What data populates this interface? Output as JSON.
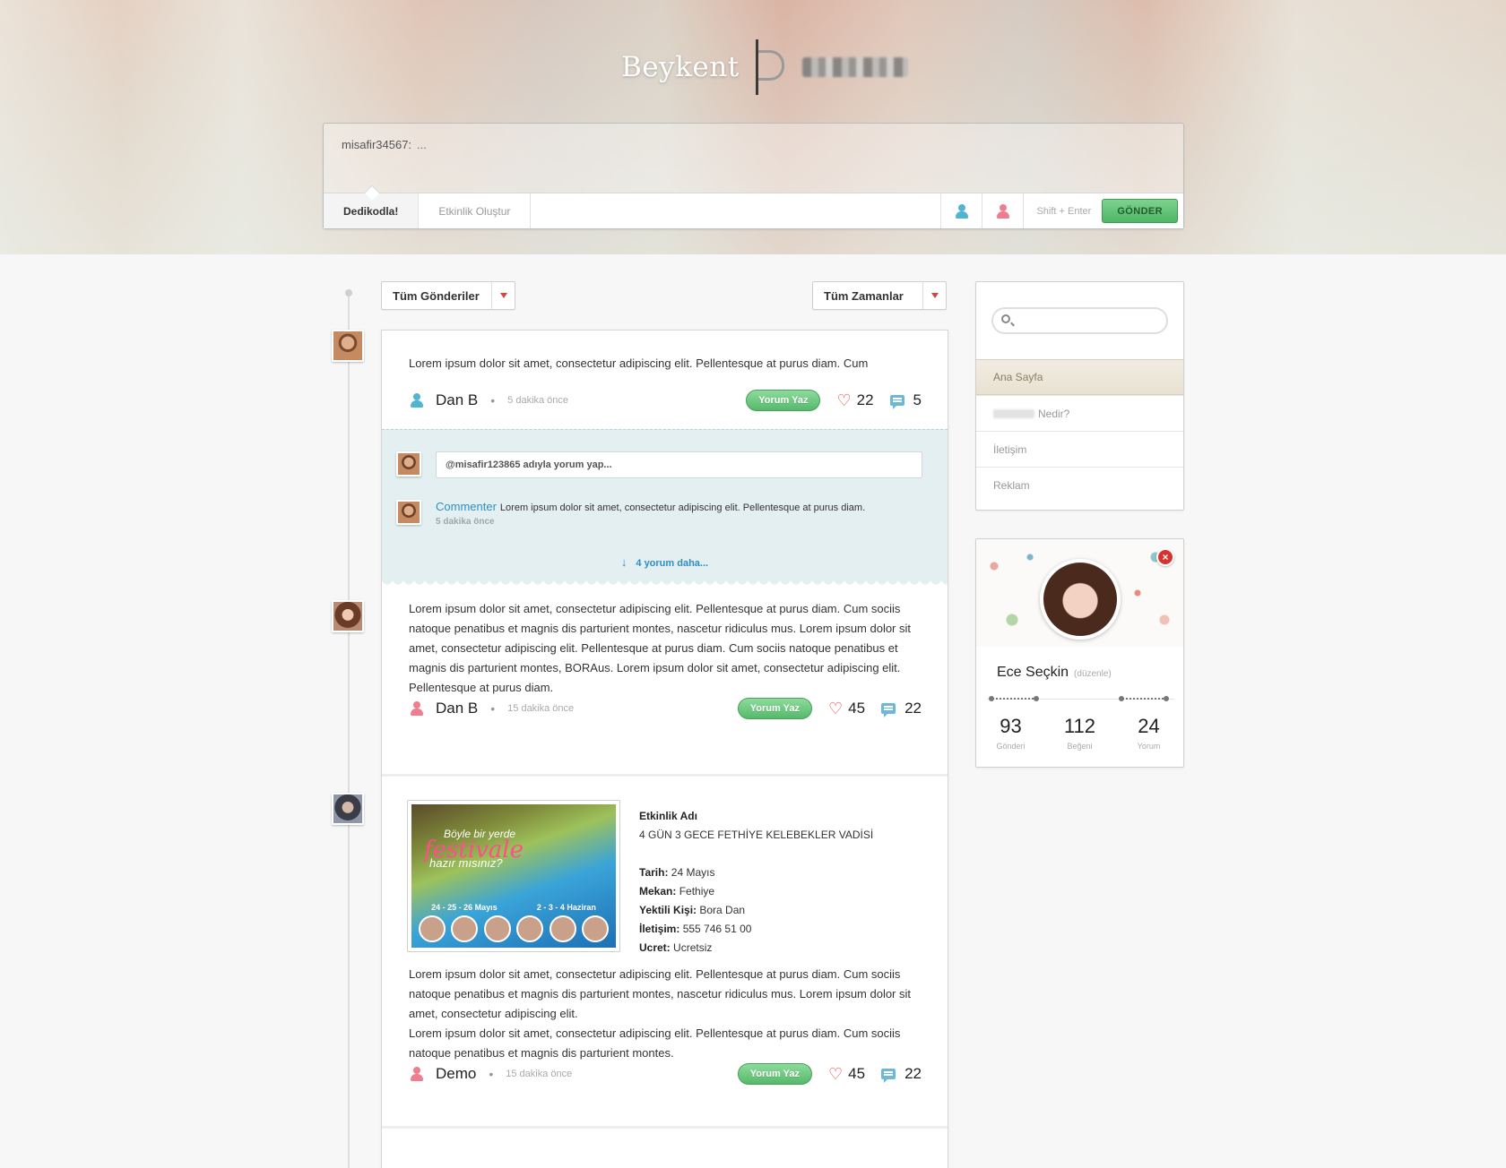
{
  "header": {
    "brand_name": "Beykent"
  },
  "composer": {
    "username": "misafir34567:",
    "placeholder": "...",
    "tabs": [
      "Dedikodla!",
      "Etkinlik Oluştur"
    ],
    "hint": "Shift + Enter",
    "send_label": "GÖNDER"
  },
  "filters": {
    "posts": "Tüm Gönderiler",
    "time": "Tüm Zamanlar"
  },
  "posts": [
    {
      "text": "Lorem ipsum dolor sit amet, consectetur adipiscing elit. Pellentesque at purus diam. Cum",
      "author": "Dan B",
      "time": "5 dakika önce",
      "comment_button": "Yorum Yaz",
      "likes": "22",
      "comments": "5"
    },
    {
      "text": "Lorem ipsum dolor sit amet, consectetur adipiscing elit. Pellentesque at purus diam. Cum sociis natoque penatibus et magnis dis parturient montes, nascetur ridiculus mus. Lorem ipsum dolor sit amet, consectetur adipiscing elit. Pellentesque at purus diam. Cum sociis natoque penatibus et magnis dis parturient montes, BORAus. Lorem ipsum dolor sit amet, consectetur adipiscing elit. Pellentesque at purus diam.",
      "author": "Dan B",
      "time": "15 dakika önce",
      "comment_button": "Yorum Yaz",
      "likes": "45",
      "comments": "22"
    },
    {
      "text_1": "Lorem ipsum dolor sit amet, consectetur adipiscing elit. Pellentesque at purus diam. Cum sociis natoque penatibus et magnis dis parturient montes, nascetur ridiculus mus. Lorem ipsum dolor sit amet, consectetur adipiscing elit.",
      "text_2": "Lorem ipsum dolor sit amet, consectetur adipiscing elit. Pellentesque at purus diam. Cum sociis natoque penatibus et magnis dis parturient montes.",
      "author": "Demo",
      "time": "15 dakika önce",
      "comment_button": "Yorum Yaz",
      "likes": "45",
      "comments": "22"
    }
  ],
  "comment_section": {
    "input_placeholder": "@misafir123865 adıyla yorum yap...",
    "commenter": "Commenter",
    "comment_text": "Lorem ipsum dolor sit amet, consectetur adipiscing elit. Pellentesque at purus diam.",
    "comment_time": "5 dakika önce",
    "more": "4 yorum daha..."
  },
  "event": {
    "poster": {
      "line1": "Böyle bir yerde",
      "line2": "festivale",
      "line3": "hazır mısınız?",
      "dates_1": "24 - 25 - 26 Mayıs",
      "dates_2": "2 - 3 - 4 Haziran"
    },
    "name_label": "Etkinlik Adı",
    "name": "4 GÜN 3 GECE FETHİYE KELEBEKLER VADİSİ",
    "date_label": "Tarih:",
    "date": "24 Mayıs",
    "place_label": "Mekan:",
    "place": "Fethiye",
    "contact_person_label": "Yektili Kişi:",
    "contact_person": "Bora Dan",
    "phone_label": "İletişim:",
    "phone": "555 746 51 00",
    "price_label": "Ucret:",
    "price": "Ucretsiz"
  },
  "sidebar": {
    "menu": [
      {
        "label": "Ana Sayfa"
      },
      {
        "label": "Nedir?"
      },
      {
        "label": "İletişim"
      },
      {
        "label": "Reklam"
      }
    ],
    "profile": {
      "name": "Ece Seçkin",
      "edit": "(düzenle)",
      "close": "×",
      "stats": [
        {
          "value": "93",
          "label": "Gönderi"
        },
        {
          "value": "112",
          "label": "Beğeni"
        },
        {
          "value": "24",
          "label": "Yorum"
        }
      ]
    }
  },
  "colors": {
    "accent_green": "#4eb566",
    "link_blue": "#2d8fc1",
    "heart_red": "#e0403a",
    "male_icon": "#52b4d0",
    "female_icon": "#ee7d90"
  }
}
